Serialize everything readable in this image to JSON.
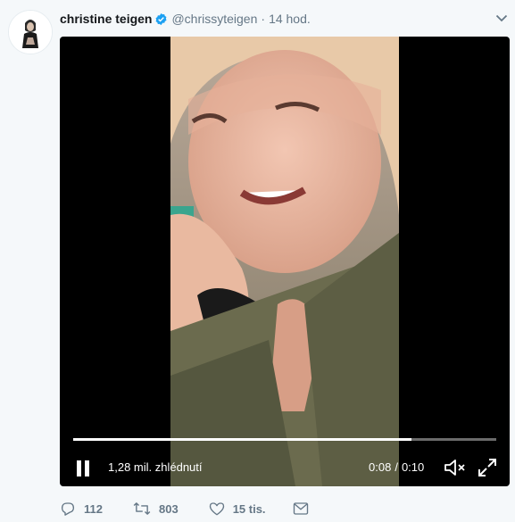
{
  "tweet": {
    "user": {
      "name": "christine teigen",
      "handle": "@chrissyteigen",
      "dot": "·",
      "time": "14 hod."
    },
    "icons": {
      "verified": "verified-badge-icon",
      "chevron": "chevron-down-icon"
    }
  },
  "video": {
    "views": "1,28 mil. zhlédnutí",
    "current_time": "0:08",
    "separator": "/",
    "duration": "0:10",
    "progress": 0.8,
    "state": "playing"
  },
  "actions": {
    "replies": "112",
    "retweets": "803",
    "likes": "15 tis."
  },
  "colors": {
    "verified": "#1da1f2",
    "meta_text": "#657786",
    "background": "#f5f8fa"
  }
}
